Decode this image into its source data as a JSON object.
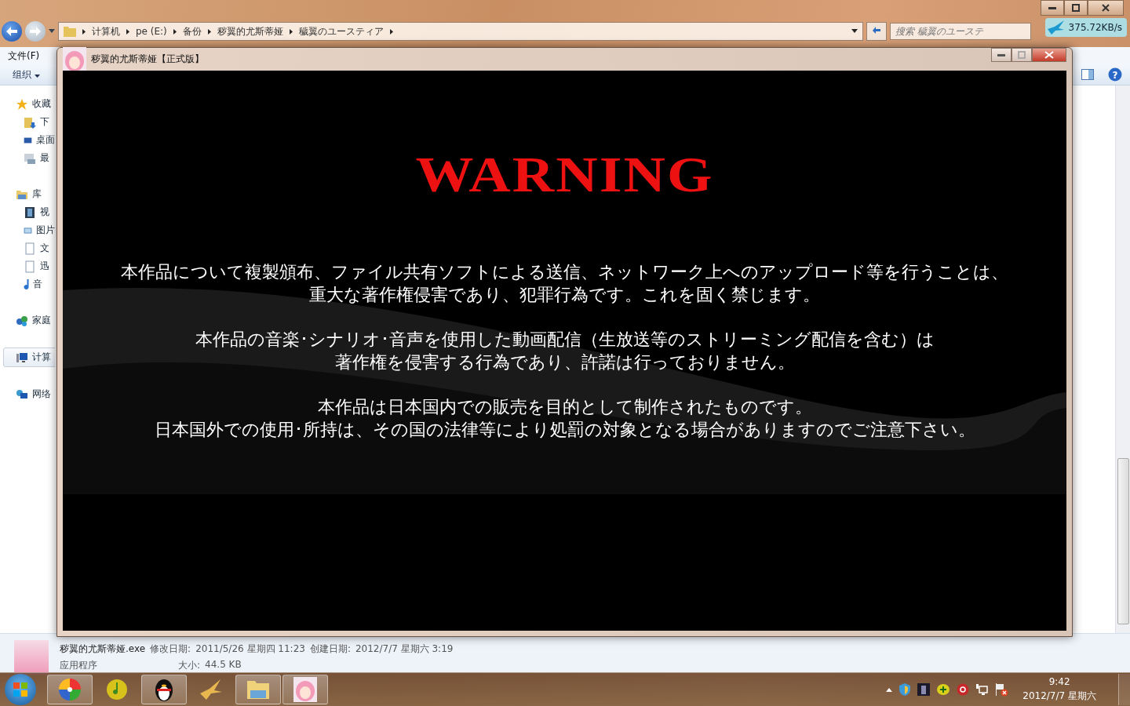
{
  "explorer": {
    "breadcrumb": [
      "计算机",
      "pe (E:)",
      "备份",
      "秽翼的尤斯蒂娅",
      "穢翼のユースティア"
    ],
    "search": {
      "placeholder": "搜索 穢翼のユーステ"
    },
    "menu": [
      "文件(F)"
    ],
    "toolbar": {
      "organize": "组织",
      "help": "?"
    },
    "nav_pane": [
      {
        "label": "收藏",
        "kind": "star",
        "selected": false,
        "children": [
          {
            "label": "下",
            "kind": "download",
            "selected": false
          },
          {
            "label": "桌面",
            "kind": "desktop",
            "selected": false
          },
          {
            "label": "最",
            "kind": "recent",
            "selected": false
          }
        ]
      },
      {
        "label": "库",
        "kind": "library",
        "selected": false,
        "children": [
          {
            "label": "视",
            "kind": "video",
            "selected": false
          },
          {
            "label": "图片",
            "kind": "picture",
            "selected": false
          },
          {
            "label": "文",
            "kind": "document",
            "selected": false
          },
          {
            "label": "迅",
            "kind": "document",
            "selected": false
          },
          {
            "label": "音",
            "kind": "music",
            "selected": false
          }
        ]
      },
      {
        "label": "家庭",
        "kind": "homegroup",
        "selected": false
      },
      {
        "label": "计算",
        "kind": "computer",
        "selected": true
      },
      {
        "label": "网络",
        "kind": "network",
        "selected": false
      }
    ],
    "details": {
      "filename": "秽翼的尤斯蒂娅.exe",
      "modified_label": "修改日期:",
      "modified": "2011/5/26 星期四 11:23",
      "created_label": "创建日期:",
      "created": "2012/7/7 星期六 3:19",
      "type": "应用程序",
      "size_label": "大小:",
      "size": "44.5 KB"
    }
  },
  "speed_widget": {
    "reading": "375.72KB/s"
  },
  "game_window": {
    "title": "秽翼的尤斯蒂娅【正式版】",
    "heading": "WARNING",
    "paragraphs": [
      [
        "本作品について複製頒布、ファイル共有ソフトによる送信、ネットワーク上へのアップロード等を行うことは、",
        "重大な著作権侵害であり、犯罪行為です。これを固く禁じます。"
      ],
      [
        "本作品の音楽･シナリオ･音声を使用した動画配信（生放送等のストリーミング配信を含む）は",
        "著作権を侵害する行為であり、許諾は行っておりません。"
      ],
      [
        "本作品は日本国内での販売を目的として制作されたものです。",
        "日本国外での使用･所持は、その国の法律等により処罰の対象となる場合がありますのでご注意下さい。"
      ]
    ]
  },
  "taskbar": {
    "apps": [
      {
        "kind": "pinwheel",
        "active": true
      },
      {
        "kind": "music",
        "active": false
      },
      {
        "kind": "penguin",
        "active": true
      },
      {
        "kind": "bird",
        "active": false
      },
      {
        "kind": "folder",
        "active": true
      },
      {
        "kind": "game",
        "active": true
      }
    ],
    "tray": [
      {
        "kind": "shield"
      },
      {
        "kind": "game"
      },
      {
        "kind": "plus"
      },
      {
        "kind": "red"
      },
      {
        "kind": "network"
      },
      {
        "kind": "flag"
      }
    ],
    "clock": {
      "time": "9:42",
      "date": "2012/7/7 星期六"
    }
  }
}
